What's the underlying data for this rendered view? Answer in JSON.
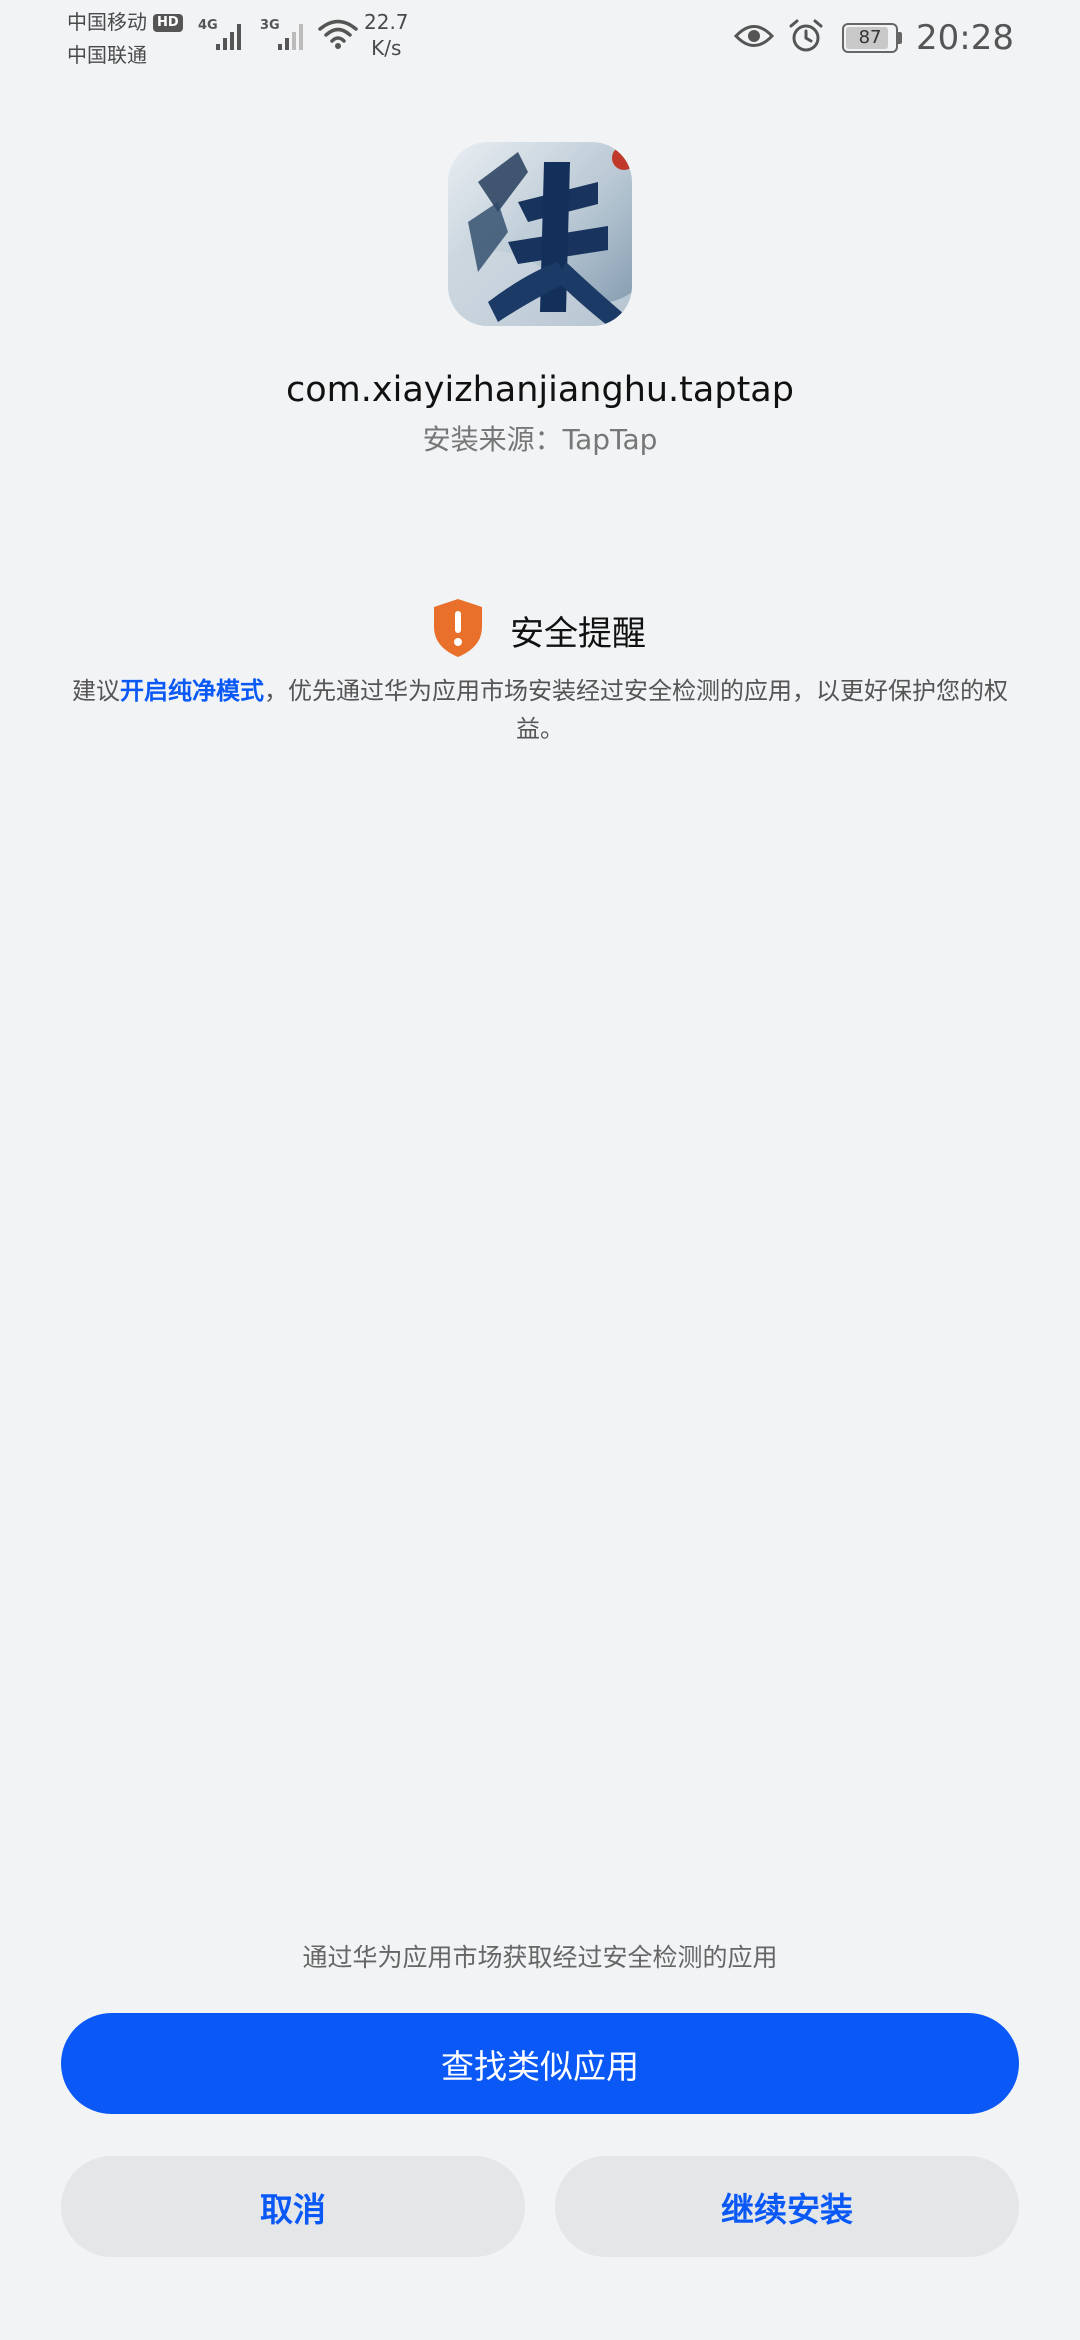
{
  "status_bar": {
    "carrier_1": "中国移动",
    "hd_badge": "HD",
    "carrier_2": "中国联通",
    "sim1_network": "4G",
    "sim2_network": "3G",
    "speed_value": "22.7",
    "speed_unit": "K/s",
    "battery_level": "87",
    "time": "20:28"
  },
  "app": {
    "icon": "app-icon-xia",
    "package_name": "com.xiayizhanjianghu.taptap",
    "install_source": "安装来源：TapTap"
  },
  "notice": {
    "icon": "shield-warning-icon",
    "title": "安全提醒",
    "text_before": "建议",
    "link_text": "开启纯净模式",
    "text_after": "，优先通过华为应用市场安装经过安全检测的应用，以更好保护您的权益。"
  },
  "footer": {
    "hint": "通过华为应用市场获取经过安全检测的应用",
    "primary_button": "查找类似应用",
    "cancel_button": "取消",
    "continue_button": "继续安装"
  },
  "colors": {
    "background": "#f1f3f5",
    "accent": "#0a59f7",
    "warning": "#e8702a",
    "secondary_button": "#e5e6e8"
  }
}
